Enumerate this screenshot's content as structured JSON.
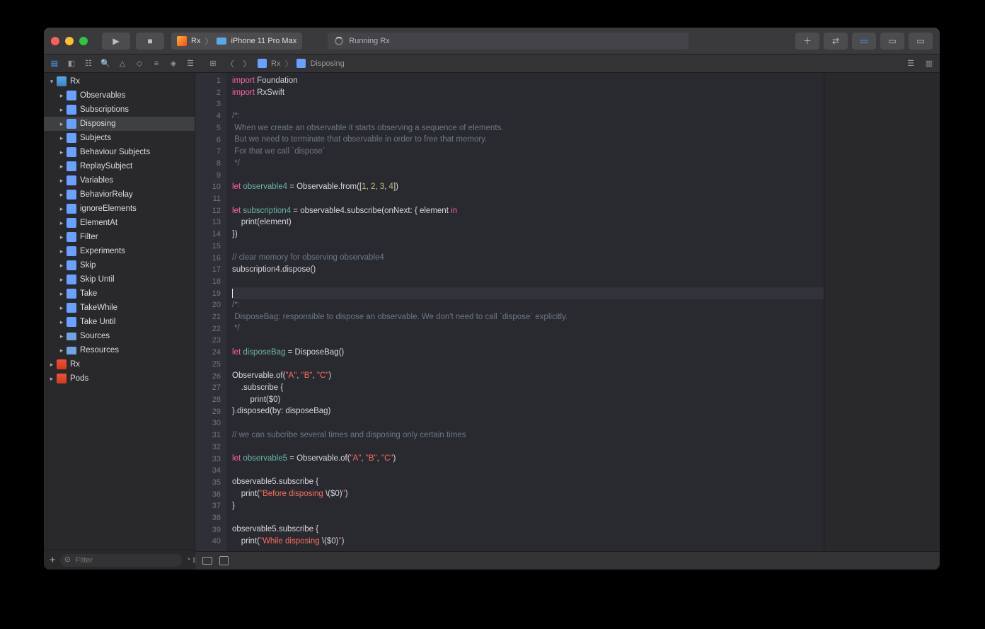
{
  "titlebar": {
    "scheme_name": "Rx",
    "device": "iPhone 11 Pro Max",
    "status_text": "Running Rx"
  },
  "breadcrumb": {
    "root": "Rx",
    "file": "Disposing"
  },
  "navigator": {
    "root": "Rx",
    "pages": [
      "Observables",
      "Subscriptions",
      "Disposing",
      "Subjects",
      "Behaviour Subjects",
      "ReplaySubject",
      "Variables",
      "BehaviorRelay",
      "ignoreElements",
      "ElementAt",
      "Filter",
      "Experiments",
      "Skip",
      "Skip Until",
      "Take",
      "TakeWhile",
      "Take Until"
    ],
    "folders": [
      "Sources",
      "Resources"
    ],
    "siblings": [
      "Rx",
      "Pods"
    ],
    "selected": "Disposing"
  },
  "filter": {
    "placeholder": "Filter"
  },
  "code": {
    "lines": [
      [
        {
          "t": "import ",
          "c": "kw"
        },
        {
          "t": "Foundation",
          "c": "type"
        }
      ],
      [
        {
          "t": "import ",
          "c": "kw"
        },
        {
          "t": "RxSwift",
          "c": "type"
        }
      ],
      [],
      [
        {
          "t": "/*:",
          "c": "cmnt"
        }
      ],
      [
        {
          "t": " When we create an observable it starts observing a sequence of elements.",
          "c": "cmnt"
        }
      ],
      [
        {
          "t": " But we need to terminate that observable in order to free that memory.",
          "c": "cmnt"
        }
      ],
      [
        {
          "t": " For that we call `dispose`",
          "c": "cmnt"
        }
      ],
      [
        {
          "t": " */",
          "c": "cmnt"
        }
      ],
      [],
      [
        {
          "t": "let ",
          "c": "kw"
        },
        {
          "t": "observable4",
          "c": "ident"
        },
        {
          "t": " = Observable.from(["
        },
        {
          "t": "1",
          "c": "num"
        },
        {
          "t": ", "
        },
        {
          "t": "2",
          "c": "num"
        },
        {
          "t": ", "
        },
        {
          "t": "3",
          "c": "num"
        },
        {
          "t": ", "
        },
        {
          "t": "4",
          "c": "num"
        },
        {
          "t": "])"
        }
      ],
      [],
      [
        {
          "t": "let ",
          "c": "kw"
        },
        {
          "t": "subscription4",
          "c": "ident"
        },
        {
          "t": " = observable4.subscribe(onNext: { element "
        },
        {
          "t": "in",
          "c": "kw"
        }
      ],
      [
        {
          "t": "    print(element)"
        }
      ],
      [
        {
          "t": "})"
        }
      ],
      [],
      [
        {
          "t": "// clear memory for observing observable4",
          "c": "cmnt"
        }
      ],
      [
        {
          "t": "subscription4.dispose()"
        }
      ],
      [],
      [
        {
          "t": ""
        }
      ],
      [
        {
          "t": "/*:",
          "c": "cmnt"
        }
      ],
      [
        {
          "t": " DisposeBag: responsible to dispose an observable. We don't need to call `dispose` explicitly.",
          "c": "cmnt"
        }
      ],
      [
        {
          "t": " */",
          "c": "cmnt"
        }
      ],
      [],
      [
        {
          "t": "let ",
          "c": "kw"
        },
        {
          "t": "disposeBag",
          "c": "ident"
        },
        {
          "t": " = DisposeBag()"
        }
      ],
      [],
      [
        {
          "t": "Observable.of("
        },
        {
          "t": "\"A\"",
          "c": "str"
        },
        {
          "t": ", "
        },
        {
          "t": "\"B\"",
          "c": "str"
        },
        {
          "t": ", "
        },
        {
          "t": "\"C\"",
          "c": "str"
        },
        {
          "t": ")"
        }
      ],
      [
        {
          "t": "    .subscribe {"
        }
      ],
      [
        {
          "t": "        print($0)"
        }
      ],
      [
        {
          "t": "}.disposed(by: disposeBag)"
        }
      ],
      [],
      [
        {
          "t": "// we can subcribe several times and disposing only certain times",
          "c": "cmnt"
        }
      ],
      [],
      [
        {
          "t": "let ",
          "c": "kw"
        },
        {
          "t": "observable5",
          "c": "ident"
        },
        {
          "t": " = Observable.of("
        },
        {
          "t": "\"A\"",
          "c": "str"
        },
        {
          "t": ", "
        },
        {
          "t": "\"B\"",
          "c": "str"
        },
        {
          "t": ", "
        },
        {
          "t": "\"C\"",
          "c": "str"
        },
        {
          "t": ")"
        }
      ],
      [],
      [
        {
          "t": "observable5.subscribe {"
        }
      ],
      [
        {
          "t": "    print("
        },
        {
          "t": "\"Before disposing ",
          "c": "str"
        },
        {
          "t": "\\($0)"
        },
        {
          "t": "\"",
          "c": "str"
        },
        {
          "t": ")"
        }
      ],
      [
        {
          "t": "}"
        }
      ],
      [],
      [
        {
          "t": "observable5.subscribe {"
        }
      ],
      [
        {
          "t": "    print("
        },
        {
          "t": "\"While disposing ",
          "c": "str"
        },
        {
          "t": "\\($0)"
        },
        {
          "t": "\"",
          "c": "str"
        },
        {
          "t": ")"
        }
      ]
    ],
    "cursor_line": 19
  }
}
